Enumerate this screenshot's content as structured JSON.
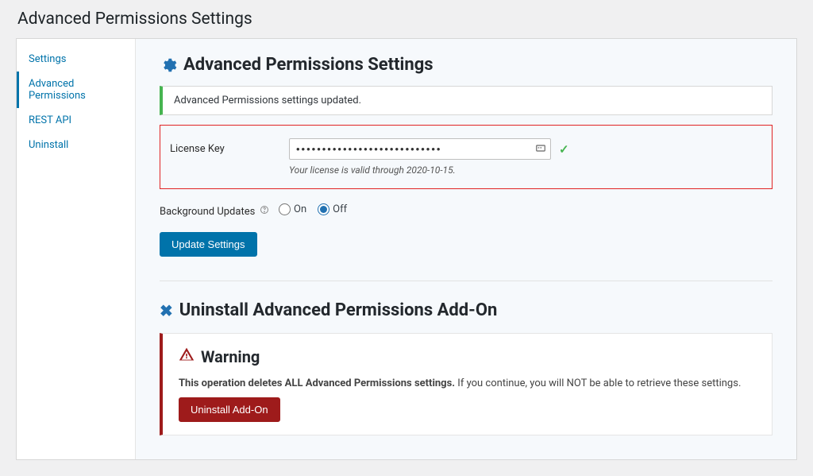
{
  "page_title": "Advanced Permissions Settings",
  "sidebar": {
    "items": [
      {
        "label": "Settings",
        "active": false
      },
      {
        "label": "Advanced Permissions",
        "active": true
      },
      {
        "label": "REST API",
        "active": false
      },
      {
        "label": "Uninstall",
        "active": false
      }
    ]
  },
  "settings": {
    "heading": "Advanced Permissions Settings",
    "notice": "Advanced Permissions settings updated.",
    "license": {
      "label": "License Key",
      "value": "••••••••••••••••••••••••••••",
      "desc": "Your license is valid through 2020-10-15."
    },
    "bg_updates": {
      "label": "Background Updates",
      "options": {
        "on": "On",
        "off": "Off"
      },
      "selected": "off"
    },
    "submit_label": "Update Settings"
  },
  "uninstall": {
    "heading": "Uninstall Advanced Permissions Add-On",
    "warning_heading": "Warning",
    "warning_bold": "This operation deletes ALL Advanced Permissions settings.",
    "warning_rest": " If you continue, you will NOT be able to retrieve these settings.",
    "button_label": "Uninstall Add-On"
  }
}
